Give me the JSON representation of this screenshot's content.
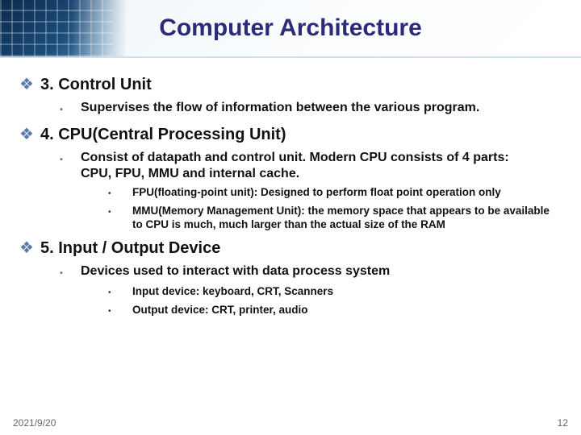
{
  "title": "Computer Architecture",
  "sections": [
    {
      "heading": "3. Control Unit",
      "subs": [
        {
          "text": "Supervises the flow of information between the various program.",
          "details": []
        }
      ]
    },
    {
      "heading": "4. CPU(Central Processing Unit)",
      "subs": [
        {
          "text": "Consist of datapath and control unit. Modern CPU consists of 4 parts: CPU, FPU, MMU and internal cache.",
          "details": [
            "FPU(floating-point unit): Designed to perform float point operation only",
            "MMU(Memory Management Unit): the memory space that appears to be available to CPU  is much, much larger than the actual size of the RAM"
          ]
        }
      ]
    },
    {
      "heading": "5. Input / Output Device",
      "subs": [
        {
          "text": "Devices used to interact with data process system",
          "details": [
            "Input device: keyboard, CRT, Scanners",
            "Output device: CRT, printer, audio"
          ]
        }
      ]
    }
  ],
  "footer": {
    "date": "2021/9/20",
    "page": "12"
  },
  "bullets": {
    "l1": "❖",
    "l2": "▪",
    "l3": "•"
  }
}
